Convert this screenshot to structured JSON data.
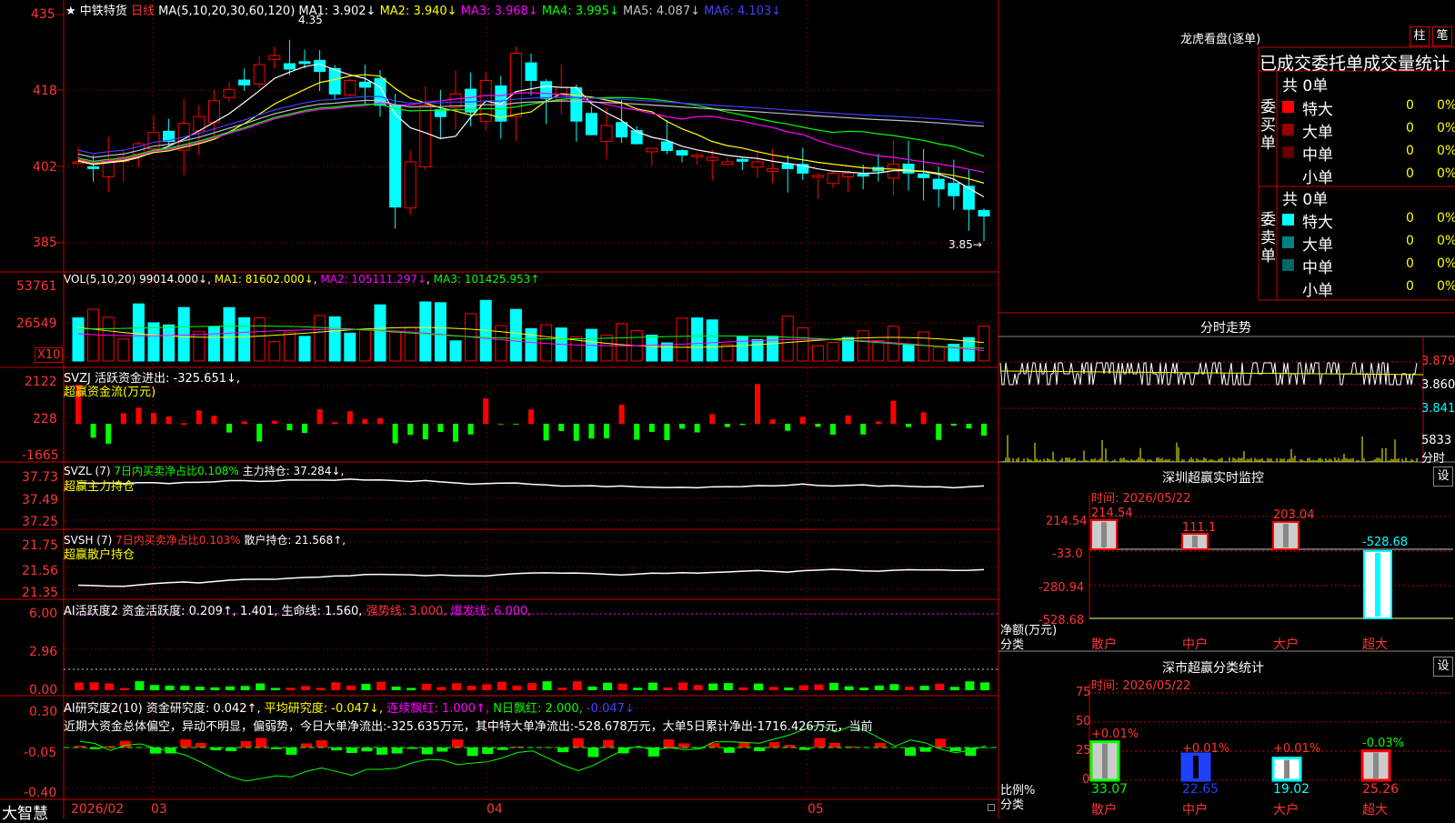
{
  "stock": {
    "star": "★",
    "name": "中铁特货",
    "period": "日线",
    "ma_header": "MA(5,10,20,30,60,120)",
    "ma": [
      {
        "label": "MA1:",
        "value": "3.902↓",
        "color": "#ffffff"
      },
      {
        "label": "MA2:",
        "value": "3.940↓",
        "color": "#ffff00"
      },
      {
        "label": "MA3:",
        "value": "3.968↓",
        "color": "#ff00ff"
      },
      {
        "label": "MA4:",
        "value": "3.995↓",
        "color": "#00ff00"
      },
      {
        "label": "MA5:",
        "value": "4.087↓",
        "color": "#c0c0c0"
      },
      {
        "label": "MA6:",
        "value": "4.103↓",
        "color": "#4040ff"
      }
    ],
    "high_mark": "4.35",
    "low_mark": "3.85→",
    "price_axis": [
      "435",
      "418",
      "402",
      "385"
    ]
  },
  "volume": {
    "header": "VOL(5,10,20)",
    "value": "99014.000↓",
    "ma1": "MA1: 81602.000↓",
    "ma2": "MA2: 105111.297↓",
    "ma3": "MA3: 101425.953↑",
    "axis": [
      "53761",
      "26549"
    ],
    "unit": "X10"
  },
  "svzj": {
    "header": "SVZJ",
    "label": "活跃资金进出: -325.651↓,",
    "sub": "超赢资金流(万元)",
    "axis": [
      "2122",
      "228",
      "-1665"
    ]
  },
  "svzl": {
    "header": "SVZL (7)",
    "ratio": "7日内买卖净占比0.108%",
    "hold": "主力持仓: 37.284↓,",
    "sub": "超赢主力持仓",
    "axis": [
      "37.73",
      "37.49",
      "37.25"
    ]
  },
  "svsh": {
    "header": "SVSH (7)",
    "ratio": "7日内买卖净占比0.103%",
    "hold": "散户持仓: 21.568↑,",
    "sub": "超赢散户持仓",
    "axis": [
      "21.75",
      "21.56",
      "21.35"
    ]
  },
  "ai_active": {
    "header": "AI活跃度2",
    "a": "资金活跃度: 0.209↑,",
    "b": "1.401,",
    "c": "生命线: 1.560,",
    "d": "强势线: 3.000,",
    "e": "爆发线: 6.000,",
    "axis": [
      "6.00",
      "2.96",
      "0.00"
    ]
  },
  "ai_research": {
    "header": "AI研究度2(10)",
    "a": "资金研究度: 0.042↑,",
    "b": "平均研究度: -0.047↓,",
    "c": "连续飘红: 1.000↑,",
    "d": "N日飘红: 2.000,",
    "e": "-0.047↓",
    "text": "近期大资金总体偏空，异动不明显，偏弱势，今日大单净流出:-325.635万元，其中特大单净流出:-528.678万元，大单5日累计净出-1716.426万元，当前",
    "axis": [
      "0.30",
      "-0.05",
      "-0.40"
    ]
  },
  "bottom_axis": {
    "brand": "大智慧",
    "labels": [
      "2026/02",
      "03",
      "04",
      "05"
    ]
  },
  "lhb": {
    "title": "龙虎看盘(逐单)",
    "btn1": "柱",
    "btn2": "笔",
    "header": "已成交委托单成交量统计",
    "buy_label": "委买单",
    "sell_label": "委卖单",
    "buy_total": "共 0单",
    "sell_total": "共 0单",
    "buy_rows": [
      {
        "name": "特大",
        "count": "0",
        "pct": "0%",
        "color": "#ff0000"
      },
      {
        "name": "大单",
        "count": "0",
        "pct": "0%",
        "color": "#990000"
      },
      {
        "name": "中单",
        "count": "0",
        "pct": "0%",
        "color": "#660000"
      },
      {
        "name": "小单",
        "count": "0",
        "pct": "0%",
        "color": "#000000"
      }
    ],
    "sell_rows": [
      {
        "name": "特大",
        "count": "0",
        "pct": "0%",
        "color": "#00ffff"
      },
      {
        "name": "大单",
        "count": "0",
        "pct": "0%",
        "color": "#008080"
      },
      {
        "name": "中单",
        "count": "0",
        "pct": "0%",
        "color": "#006666"
      },
      {
        "name": "小单",
        "count": "0",
        "pct": "0%",
        "color": "#000000"
      }
    ]
  },
  "intraday": {
    "title": "分时走势",
    "axis": [
      "3.879",
      "3.860",
      "3.841"
    ],
    "vol_label": "5833",
    "vol_unit": "分时"
  },
  "sz_monitor": {
    "title": "深圳超赢实时监控",
    "btn": "设",
    "time": "时间: 2026/05/22",
    "y_axis": [
      "214.54",
      "-33.0",
      "-280.94",
      "-528.68"
    ],
    "ylabel": "净额(万元)",
    "xlabel": "分类",
    "categories": [
      "散户",
      "中户",
      "大户",
      "超大"
    ],
    "values_text": [
      "214.54",
      "111.1",
      "203.04",
      "-528.68"
    ]
  },
  "sz_class": {
    "title": "深市超赢分类统计",
    "btn": "设",
    "time": "时间: 2026/05/22",
    "y_axis": [
      "75",
      "50",
      "25",
      "0"
    ],
    "ylabel": "比例%",
    "xlabel": "分类",
    "categories": [
      "散户",
      "中户",
      "大户",
      "超大"
    ],
    "pct_values": [
      "33.07",
      "22.65",
      "19.02",
      "25.26"
    ],
    "changes": [
      "+0.01%",
      "+0.01%",
      "+0.01%",
      "-0.03%"
    ]
  },
  "chart_data": [
    {
      "type": "candlestick",
      "title": "中铁特货 日线",
      "ylim": [
        385,
        435
      ],
      "y_ticks": [
        "435",
        "418",
        "402",
        "385"
      ],
      "x_labels": [
        "2026/02",
        "03",
        "04",
        "05"
      ],
      "annotations": [
        "4.35",
        "3.85"
      ]
    },
    {
      "type": "bar",
      "title": "VOL(5,10,20)",
      "y_ticks": [
        "53761",
        "26549"
      ],
      "unit": "X10"
    },
    {
      "type": "bar",
      "title": "SVZJ",
      "y_ticks": [
        "2122",
        "228",
        "-1665"
      ]
    },
    {
      "type": "bar",
      "title": "深圳超赢实时监控",
      "categories": [
        "散户",
        "中户",
        "大户",
        "超大"
      ],
      "values": [
        214.54,
        111.1,
        203.04,
        -528.68
      ],
      "ylabel": "净额(万元)",
      "xlabel": "分类"
    },
    {
      "type": "bar",
      "title": "深市超赢分类统计",
      "categories": [
        "散户",
        "中户",
        "大户",
        "超大"
      ],
      "values": [
        33.07,
        22.65,
        19.02,
        25.26
      ],
      "ylim": [
        0,
        75
      ],
      "ylabel": "比例%",
      "xlabel": "分类"
    }
  ],
  "colors": {
    "up": "#ff0000",
    "down": "#00ffff",
    "grid": "#cc0000",
    "axis_text": "#ff3333"
  }
}
